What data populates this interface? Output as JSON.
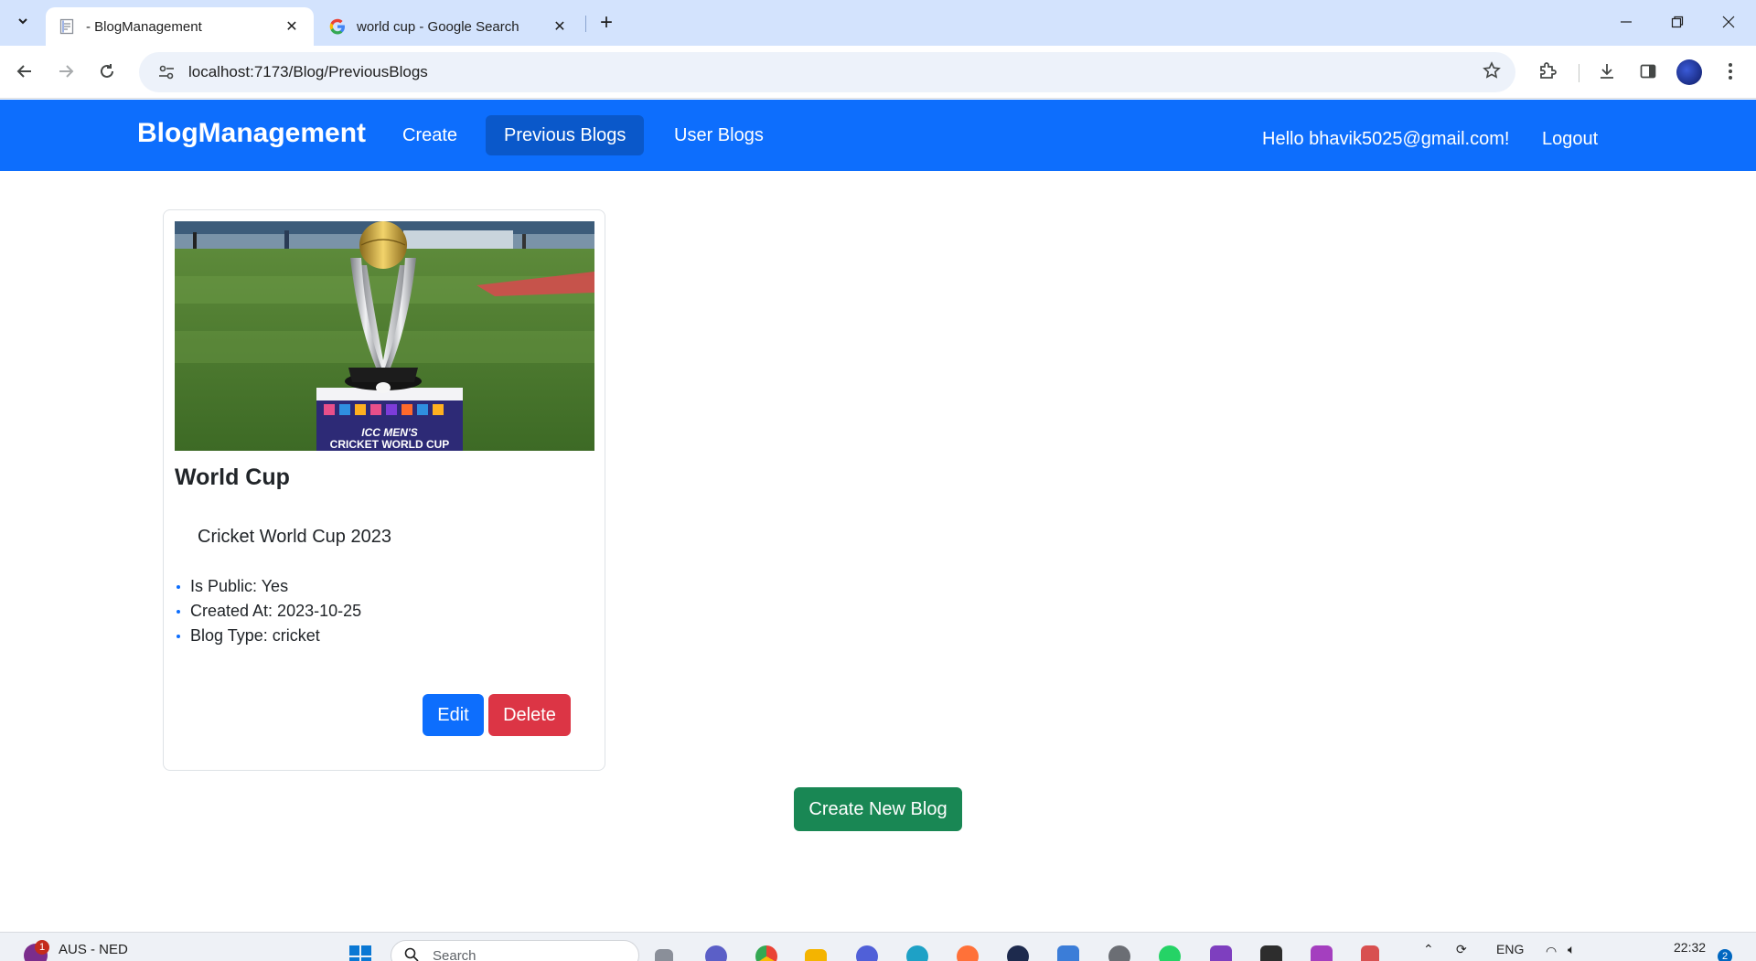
{
  "browser": {
    "tabs": [
      {
        "title": "- BlogManagement",
        "active": true
      },
      {
        "title": "world cup - Google Search",
        "active": false
      }
    ],
    "url": "localhost:7173/Blog/PreviousBlogs"
  },
  "navbar": {
    "brand": "BlogManagement",
    "links": [
      {
        "label": "Create",
        "active": false
      },
      {
        "label": "Previous Blogs",
        "active": true
      },
      {
        "label": "User Blogs",
        "active": false
      }
    ],
    "greeting": "Hello bhavik5025@gmail.com!",
    "logout": "Logout"
  },
  "blog": {
    "image_caption_line1": "ICC MEN'S",
    "image_caption_line2": "CRICKET WORLD CUP",
    "title": "World Cup",
    "description": "Cricket World Cup 2023",
    "meta": [
      "Is Public: Yes",
      "Created At: 2023-10-25",
      "Blog Type: cricket"
    ],
    "edit_label": "Edit",
    "delete_label": "Delete"
  },
  "create_new_label": "Create New Blog",
  "taskbar": {
    "weather_badge": "1",
    "weather_text": "AUS - NED",
    "search_placeholder": "Search",
    "language": "ENG",
    "time": "22:32",
    "notification_count": "2"
  },
  "colors": {
    "primary": "#0d6efd",
    "primary_active": "#0a58ca",
    "danger": "#dc3545",
    "success": "#198754",
    "tabstrip": "#d3e3fd"
  }
}
